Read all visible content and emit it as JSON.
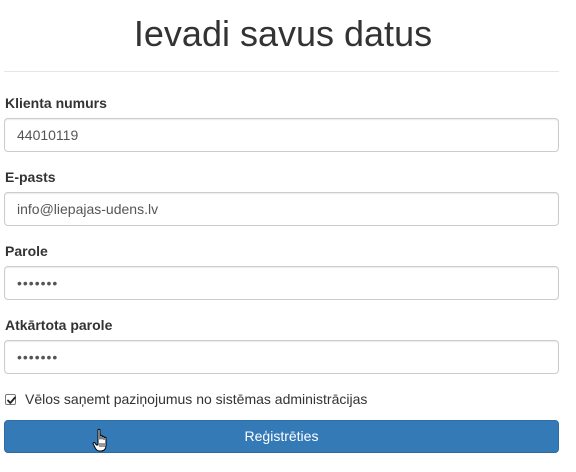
{
  "header": {
    "title": "Ievadi savus datus"
  },
  "form": {
    "client_number": {
      "label": "Klienta numurs",
      "value": "44010119"
    },
    "email": {
      "label": "E-pasts",
      "value": "info@liepajas-udens.lv"
    },
    "password": {
      "label": "Parole",
      "value": "•••••••"
    },
    "password_repeat": {
      "label": "Atkārtota parole",
      "value": "•••••••"
    },
    "notifications": {
      "label": "Vēlos saņemt paziņojumus no sistēmas administrācijas",
      "checked": true
    },
    "submit_label": "Reģistrēties"
  },
  "colors": {
    "primary": "#337ab7",
    "primary_border": "#2e6da4",
    "text": "#333333",
    "input_border": "#cccccc"
  },
  "icons": {
    "checkbox": "check-icon",
    "cursor": "hand-pointer-icon"
  }
}
